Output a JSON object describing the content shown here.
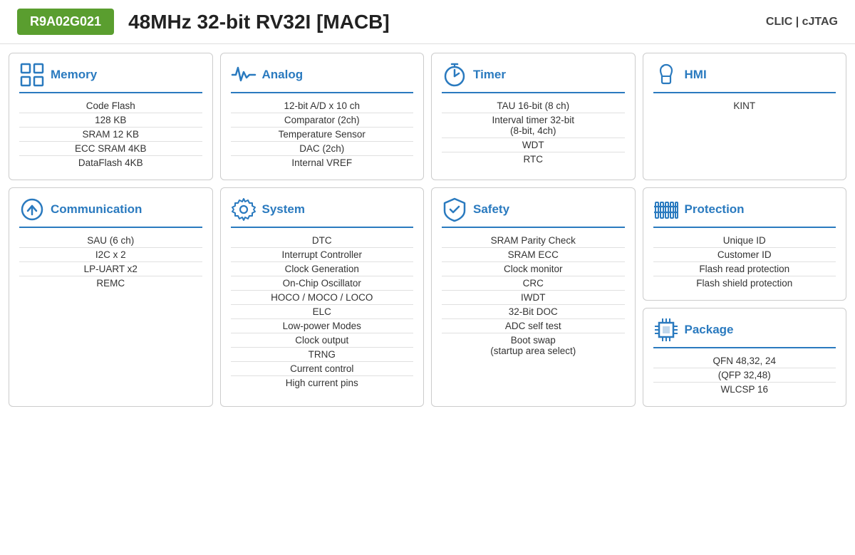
{
  "header": {
    "badge": "R9A02G021",
    "title": "48MHz 32-bit RV32I [MACB]",
    "tags": "CLIC  |  cJTAG"
  },
  "cards": [
    {
      "id": "memory",
      "title": "Memory",
      "icon": "grid-icon",
      "items": [
        "Code Flash",
        "128 KB",
        "SRAM 12 KB",
        "ECC SRAM 4KB",
        "DataFlash 4KB"
      ]
    },
    {
      "id": "analog",
      "title": "Analog",
      "icon": "waveform-icon",
      "items": [
        "12-bit A/D x 10 ch",
        "Comparator (2ch)",
        "Temperature Sensor",
        "DAC (2ch)",
        "Internal VREF"
      ]
    },
    {
      "id": "timer",
      "title": "Timer",
      "icon": "timer-icon",
      "items": [
        "TAU 16-bit (8 ch)",
        "Interval timer 32-bit\n(8-bit, 4ch)",
        "WDT",
        "RTC"
      ]
    },
    {
      "id": "hmi",
      "title": "HMI",
      "icon": "touch-icon",
      "items": [
        "KINT"
      ]
    },
    {
      "id": "communication",
      "title": "Communication",
      "icon": "upload-icon",
      "items": [
        "SAU (6 ch)",
        "I2C x 2",
        "LP-UART x2",
        "REMC"
      ]
    },
    {
      "id": "system",
      "title": "System",
      "icon": "gear-icon",
      "items": [
        "DTC",
        "Interrupt Controller",
        "Clock Generation",
        "On-Chip Oscillator",
        "HOCO / MOCO / LOCO",
        "ELC",
        "Low-power Modes",
        "Clock output",
        "TRNG",
        "Current control",
        "High current pins"
      ]
    },
    {
      "id": "safety",
      "title": "Safety",
      "icon": "shield-icon",
      "items": [
        "SRAM Parity Check",
        "SRAM ECC",
        "Clock monitor",
        "CRC",
        "IWDT",
        "32-Bit DOC",
        "ADC self test",
        "Boot swap\n(startup area select)"
      ]
    },
    {
      "id": "protection",
      "title": "Protection",
      "icon": "fence-icon",
      "items": [
        "Unique ID",
        "Customer ID",
        "Flash read protection",
        "Flash shield protection"
      ]
    },
    {
      "id": "package",
      "title": "Package",
      "icon": "chip-icon",
      "items": [
        "QFN 48,32, 24",
        "(QFP 32,48)",
        "WLCSP 16"
      ]
    }
  ]
}
